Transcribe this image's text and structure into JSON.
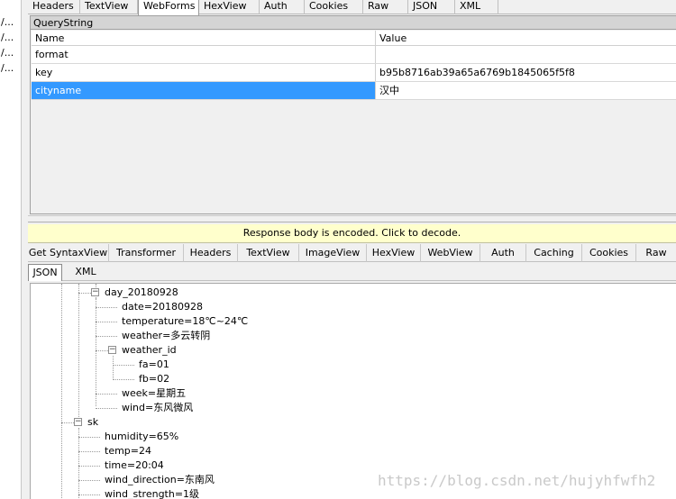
{
  "left_strip": {
    "rows": [
      "/...",
      "/...",
      "/...",
      "/..."
    ]
  },
  "request_tabs": [
    "Headers",
    "TextView",
    "WebForms",
    "HexView",
    "Auth",
    "Cookies",
    "Raw",
    "JSON",
    "XML"
  ],
  "querystring": {
    "title": "QueryString",
    "headers": {
      "name": "Name",
      "value": "Value"
    },
    "rows": [
      {
        "name": "format",
        "value": ""
      },
      {
        "name": "key",
        "value": "b95b8716ab39a65a6769b1845065f5f8"
      },
      {
        "name": "cityname",
        "value": "汉中"
      }
    ]
  },
  "notice": "Response body is encoded. Click to decode.",
  "response_tabs": [
    "Get SyntaxView",
    "Transformer",
    "Headers",
    "TextView",
    "ImageView",
    "HexView",
    "WebView",
    "Auth",
    "Caching",
    "Cookies",
    "Raw"
  ],
  "response_subtabs": [
    "JSON",
    "XML"
  ],
  "tree": {
    "day_node": "day_20180928",
    "day_children": [
      "date=20180928",
      "temperature=18℃~24℃",
      "weather=多云转阴"
    ],
    "weather_id": "weather_id",
    "weather_id_children": [
      "fa=01",
      "fb=02"
    ],
    "day_children_tail": [
      "week=星期五",
      "wind=东风微风"
    ],
    "sk_node": "sk",
    "sk_children": [
      "humidity=65%",
      "temp=24",
      "time=20:04",
      "wind_direction=东南风",
      "wind_strength=1级"
    ]
  },
  "watermark": "https://blog.csdn.net/hujyhfwfh2"
}
